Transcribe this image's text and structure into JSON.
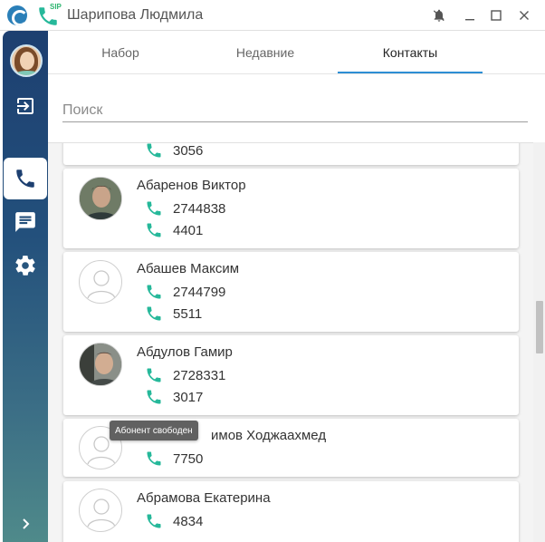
{
  "window": {
    "title": "Шарипова Людмила",
    "sip_label": "SIP"
  },
  "sidebar": {
    "items": [
      "logout-icon",
      "phone-icon",
      "chat-icon",
      "gear-icon",
      "chevron-right-icon"
    ],
    "active": "phone-icon"
  },
  "tabs": [
    {
      "label": "Набор"
    },
    {
      "label": "Недавние"
    },
    {
      "label": "Контакты",
      "active": true
    }
  ],
  "search": {
    "placeholder": "Поиск",
    "value": ""
  },
  "contacts": [
    {
      "name": "",
      "numbers": [
        "3056"
      ]
    },
    {
      "name": "Абаренов Виктор",
      "numbers": [
        "2744838",
        "4401"
      ],
      "has_photo": true
    },
    {
      "name": "Абашев Максим",
      "numbers": [
        "2744799",
        "5511"
      ]
    },
    {
      "name": "Абдулов Гамир",
      "numbers": [
        "2728331",
        "3017"
      ],
      "has_photo": true
    },
    {
      "name": "имов Ходжаахмед",
      "numbers": [
        "7750"
      ]
    },
    {
      "name": "Абрамова Екатерина",
      "numbers": [
        "4834"
      ]
    }
  ],
  "tooltip": {
    "text": "Абонент свободен"
  },
  "colors": {
    "accent": "#2d8ed4",
    "phone_green": "#26b89a",
    "sidebar_top": "#1d3f70",
    "sidebar_bottom": "#4f8a8a"
  }
}
